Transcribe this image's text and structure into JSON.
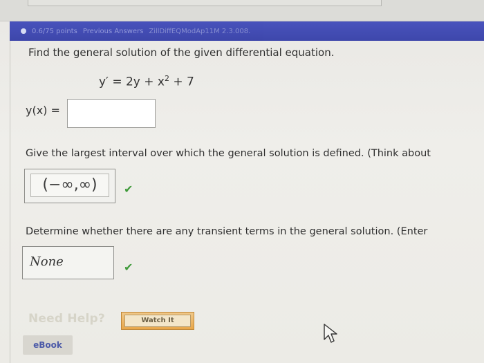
{
  "header": {
    "points": "0.6/75 points",
    "previous_answers": "Previous Answers",
    "problem_code": "ZillDiffEQModAp11M 2.3.008."
  },
  "question": {
    "title": "Find the general solution of the given differential equation.",
    "equation_lhs": "y′ = 2y + x",
    "equation_exp": "2",
    "equation_rhs": " + 7",
    "answer_label": "y(x) =",
    "answer_value": ""
  },
  "interval": {
    "prompt": "Give the largest interval over which the general solution is defined. (Think about",
    "answer": "(−∞,∞)",
    "status_icon": "check-icon"
  },
  "transient": {
    "prompt": "Determine whether there are any transient terms in the general solution. (Enter",
    "answer": "None",
    "status_icon": "check-icon"
  },
  "help": {
    "need_help": "Need Help?",
    "watch_label": "Watch It",
    "ebook_label": "eBook"
  },
  "colors": {
    "header_bar": "#2f39a6",
    "check_green": "#3f9a3a",
    "watch_orange": "#e8a74a"
  }
}
